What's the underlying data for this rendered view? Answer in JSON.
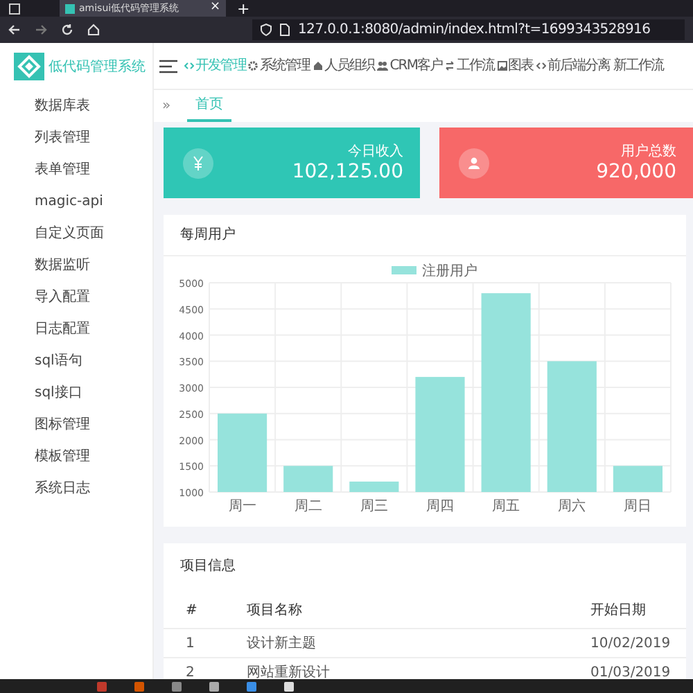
{
  "browser": {
    "tab_title": "amisui低代码管理系统",
    "tab_close": "×",
    "new_tab": "+",
    "url": "127.0.0.1:8080/admin/index.html?t=1699343528916"
  },
  "app": {
    "logo_text": "低代码管理系统"
  },
  "topnav": [
    {
      "label": "开发管理",
      "selected": true
    },
    {
      "label": "系统管理",
      "selected": false
    },
    {
      "label": "人员组织",
      "selected": false
    },
    {
      "label": "CRM客户",
      "selected": false
    },
    {
      "label": "工作流",
      "selected": false
    },
    {
      "label": "图表",
      "selected": false
    },
    {
      "label": "前后端分离",
      "selected": false
    },
    {
      "label": "新工作流",
      "selected": false
    }
  ],
  "sidebar": {
    "items": [
      "数据库表",
      "列表管理",
      "表单管理",
      "magic-api",
      "自定义页面",
      "数据监听",
      "导入配置",
      "日志配置",
      "sql语句",
      "sql接口",
      "图标管理",
      "模板管理",
      "系统日志"
    ]
  },
  "breadcrumb": {
    "toggle": "»",
    "tabs": [
      {
        "label": "首页",
        "selected": true
      }
    ]
  },
  "stats": [
    {
      "label": "今日收入",
      "value": "102,125.00",
      "color": "#2fc6b5"
    },
    {
      "label": "用户总数",
      "value": "920,000",
      "color": "#f76868"
    }
  ],
  "chart_card": {
    "title": "每周用户",
    "chart_data": {
      "type": "bar",
      "categories": [
        "周一",
        "周二",
        "周三",
        "周四",
        "周五",
        "周六",
        "周日"
      ],
      "series": [
        {
          "name": "注册用户",
          "color": "#96e3dc",
          "values": [
            2500,
            1500,
            1200,
            3200,
            4800,
            3500,
            1500
          ]
        }
      ],
      "ylim": [
        1000,
        5000
      ],
      "yticks": [
        1000,
        1500,
        2000,
        2500,
        3000,
        3500,
        4000,
        4500,
        5000
      ],
      "grid": true
    }
  },
  "table_card": {
    "title": "项目信息",
    "columns": [
      "#",
      "项目名称",
      "开始日期"
    ],
    "rows": [
      [
        "1",
        "设计新主题",
        "10/02/2019"
      ],
      [
        "2",
        "网站重新设计",
        "01/03/2019"
      ]
    ]
  }
}
